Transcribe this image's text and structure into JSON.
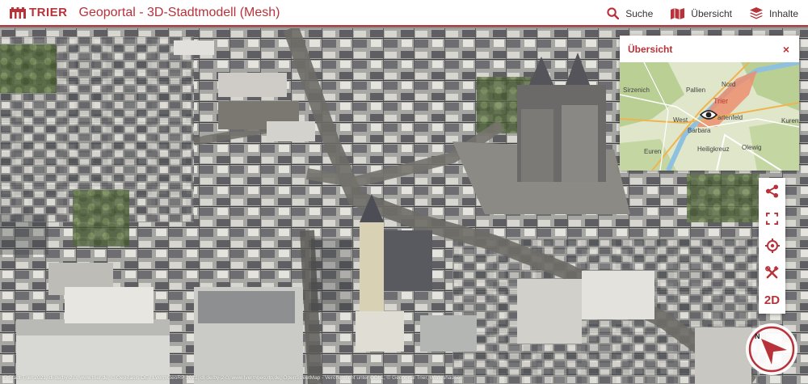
{
  "header": {
    "logo_text": "TRIER",
    "title": "Geoportal - 3D-Stadtmodell (Mesh)",
    "nav": [
      {
        "label": "Suche",
        "icon": "search-icon"
      },
      {
        "label": "Übersicht",
        "icon": "map-icon"
      },
      {
        "label": "Inhalte",
        "icon": "layers-icon"
      }
    ]
  },
  "overview": {
    "title": "Übersicht",
    "close_label": "×",
    "labels": [
      "Sirzenich",
      "Pallien",
      "Nord",
      "Trier",
      "West",
      "artenfeld",
      "Barbara",
      "Kuren",
      "Euren",
      "Heiligkreuz",
      "Olewig"
    ]
  },
  "toolbar": {
    "tools": [
      "share-icon",
      "fullscreen-icon",
      "locate-icon",
      "tools-icon"
    ],
    "mode_label": "2D"
  },
  "compass": {
    "north_label": "N"
  },
  "attribution": "© Stadt Trier 2021, dl-de/by-2.0, www.trier.de, © GeoBasis-DE / LVermGeoRP 2021, dl-de/by-2-0, www.lvermgeo.rlp.de, OpenStreetMap - Veröffentlicht unter ODbL, © Geoportal Trier, Wildeshausen",
  "colors": {
    "accent": "#b8323a"
  }
}
